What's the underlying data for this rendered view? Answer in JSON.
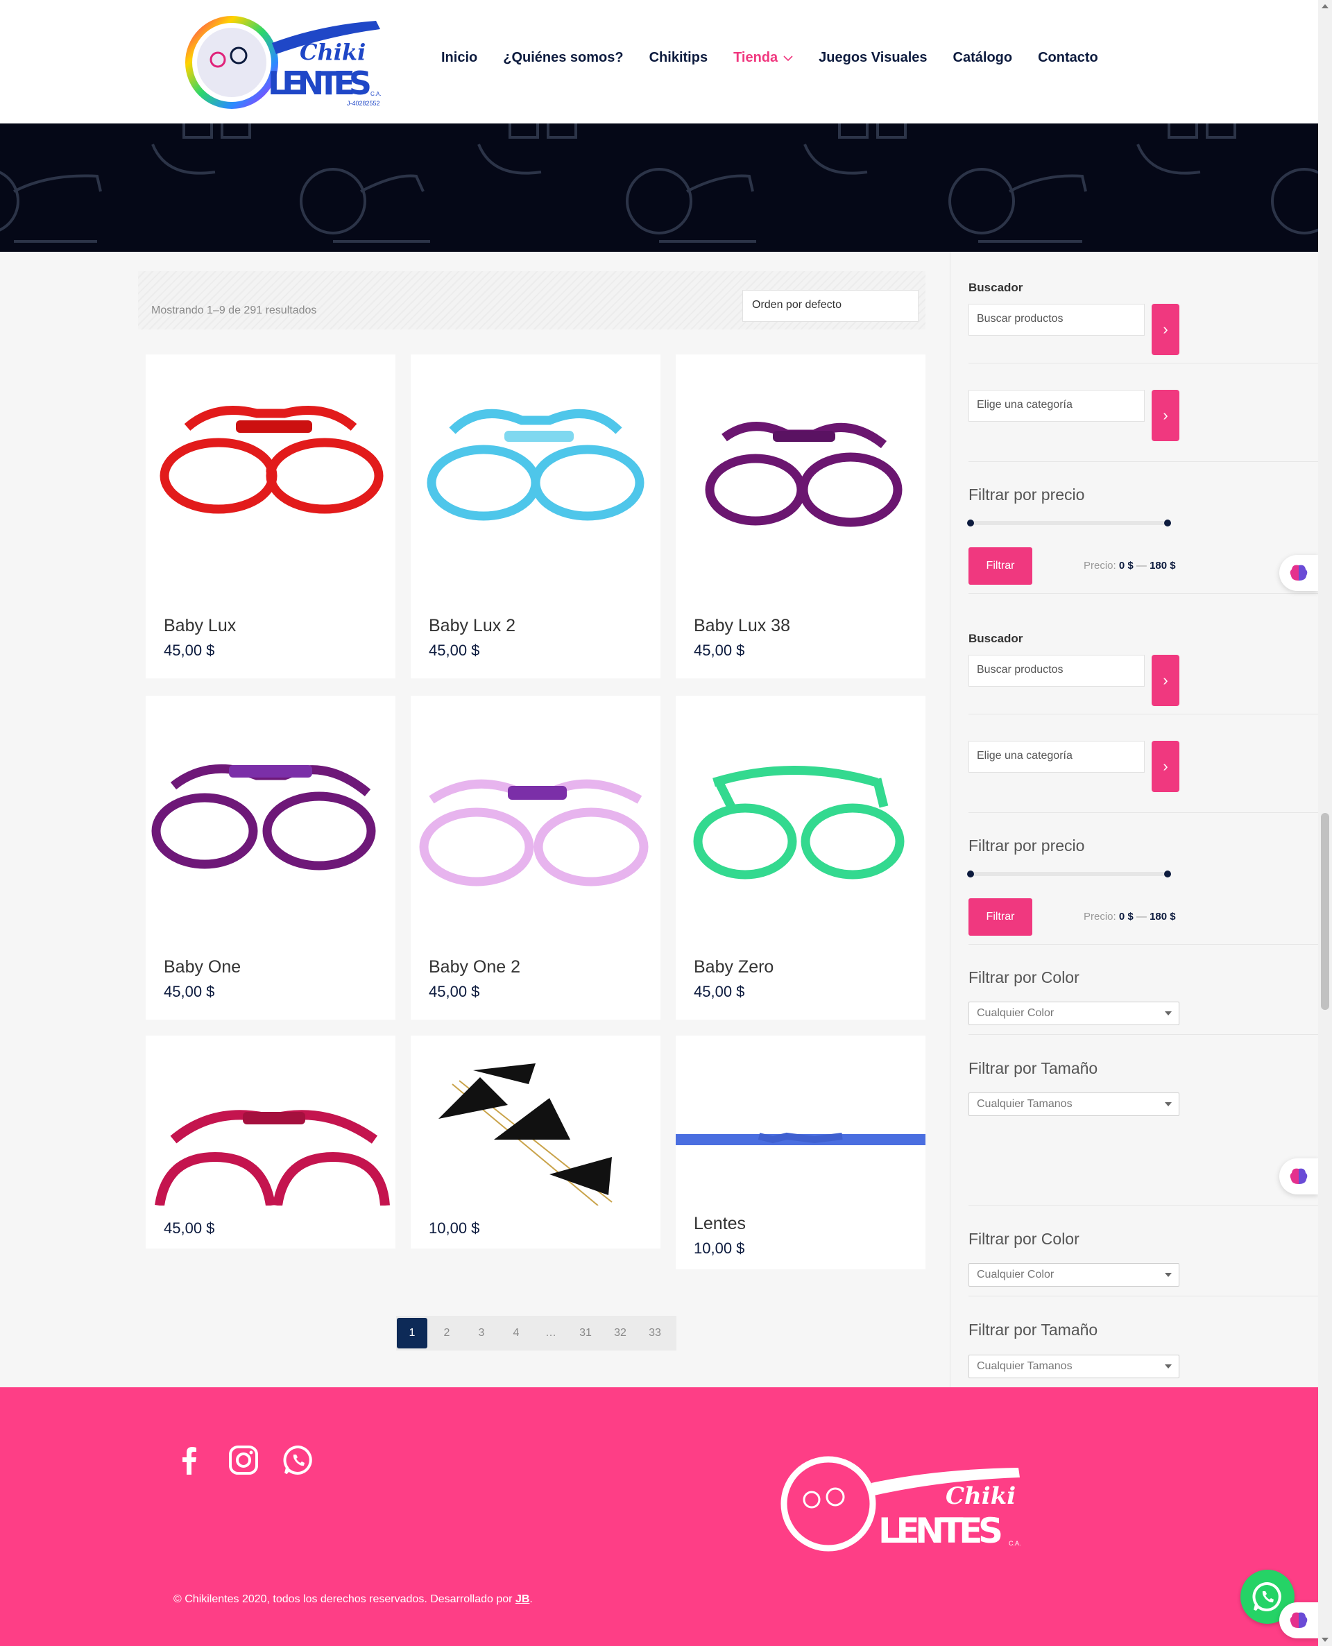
{
  "brand": {
    "logo_word1": "Chiki",
    "logo_word2": "LENTES",
    "logo_suffix": "C.A.",
    "logo_rif": "J-40282552"
  },
  "nav": {
    "items": [
      {
        "label": "Inicio"
      },
      {
        "label": "¿Quiénes somos?"
      },
      {
        "label": "Chikitips"
      },
      {
        "label": "Tienda",
        "active": true
      },
      {
        "label": "Juegos Visuales"
      },
      {
        "label": "Catálogo"
      },
      {
        "label": "Contacto"
      }
    ]
  },
  "shop": {
    "result_count": "Mostrando 1–9 de 291 resultados",
    "orderby": "Orden por defecto",
    "products": [
      {
        "name": "Baby Lux",
        "price": "45,00 $",
        "color": "#e21b1b"
      },
      {
        "name": "Baby Lux 2",
        "price": "45,00 $",
        "color": "#4ec6ea"
      },
      {
        "name": "Baby Lux 38",
        "price": "45,00 $",
        "color": "#6b1670"
      },
      {
        "name": "Baby One",
        "price": "45,00 $",
        "color": "#6e1878"
      },
      {
        "name": "Baby One 2",
        "price": "45,00 $",
        "color": "#e7b4ee"
      },
      {
        "name": "Baby Zero",
        "price": "45,00 $",
        "color": "#33d98f"
      },
      {
        "name": "",
        "price": "45,00 $",
        "color": "#c4144e"
      },
      {
        "name": "",
        "price": "10,00 $",
        "color": "#111111"
      },
      {
        "name": "Lentes",
        "price": "10,00 $",
        "color": "#4a6ee0"
      }
    ],
    "pagination": [
      "1",
      "2",
      "3",
      "4",
      "…",
      "31",
      "32",
      "33"
    ]
  },
  "sidebar": {
    "search_label": "Buscador",
    "search_placeholder": "Buscar productos",
    "category_placeholder": "Elige una categoría",
    "price_title": "Filtrar por precio",
    "filter_button": "Filtrar",
    "price_prefix": "Precio:",
    "price_min": "0 $",
    "price_dash": "—",
    "price_max": "180 $",
    "color_title": "Filtrar por Color",
    "color_placeholder": "Cualquier Color",
    "size_title": "Filtrar por Tamaño",
    "size_placeholder": "Cualquier Tamanos",
    "go_glyph": "›"
  },
  "footer": {
    "copyright": "© Chikilentes 2020, todos los derechos reservados. Desarrollado por ",
    "dev": "JB",
    "period": "."
  },
  "colors": {
    "accent": "#f0387f",
    "navy": "#0d1b3e",
    "footer": "#fe3e86",
    "hero": "#050817",
    "whatsapp": "#25d366"
  }
}
